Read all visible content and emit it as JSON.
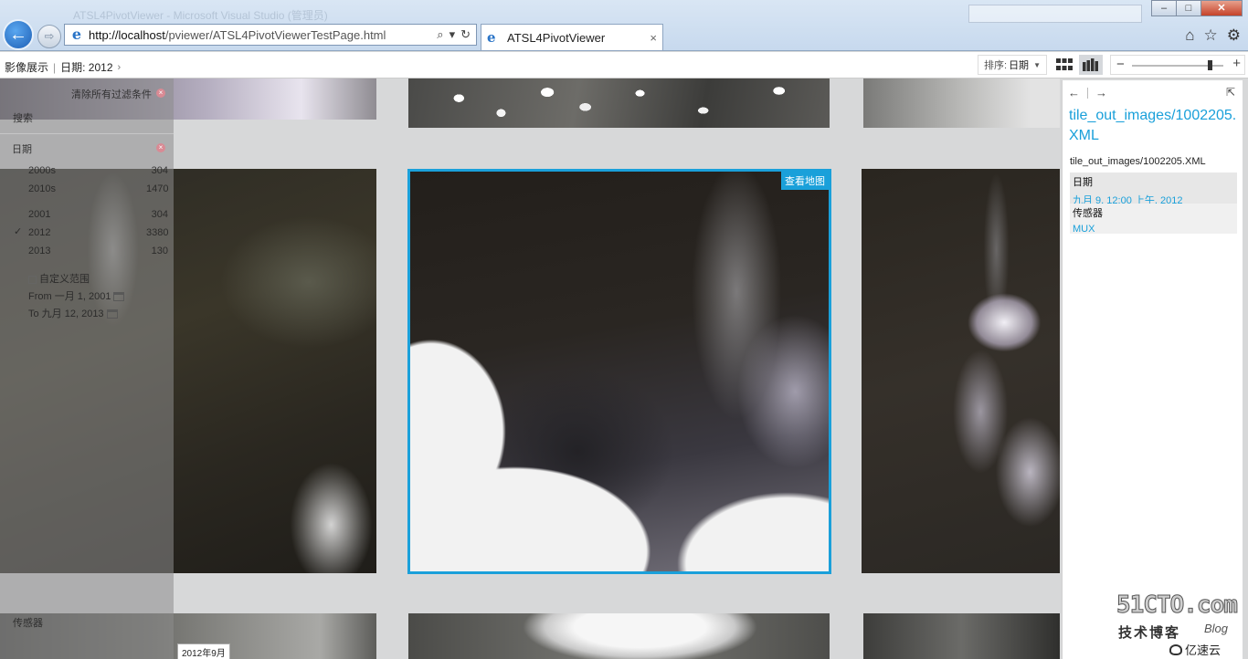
{
  "browser": {
    "window_title": "ATSL4PivotViewer - Microsoft Visual Studio (管理员)",
    "address_url_host": "http://localhost",
    "address_url_path": "/pviewer/ATSL4PivotViewerTestPage.html",
    "tab_title": "ATSL4PivotViewer",
    "tab_close": "×",
    "back_glyph": "←",
    "forward_glyph": "⇨",
    "search_glyph": "⌕",
    "dropdown_glyph": "▾",
    "refresh_glyph": "↻",
    "icons": {
      "home": "⌂",
      "favorites": "☆",
      "tools": "⚙"
    },
    "window_controls": {
      "minimize": "–",
      "maximize": "□",
      "close": "✕"
    }
  },
  "toolbar": {
    "breadcrumb_root": "影像展示",
    "breadcrumb_sep": "|",
    "breadcrumb_filter": "日期: 2012",
    "breadcrumb_chevron": "›",
    "sort_label": "排序:",
    "sort_value": "日期",
    "zoom_minus": "−",
    "zoom_plus": "+",
    "zoom_level": 0.86
  },
  "filter_panel": {
    "clear_all": "清除所有过滤条件",
    "search_label": "搜索",
    "search_count": "",
    "date_facet": "日期",
    "decades": [
      {
        "label": "2000s",
        "count": "304"
      },
      {
        "label": "2010s",
        "count": "1470"
      }
    ],
    "years": [
      {
        "label": "2001",
        "count": "304"
      },
      {
        "label": "2012",
        "count": "3380",
        "checked": true
      },
      {
        "label": "2013",
        "count": "130"
      }
    ],
    "custom_range": "自定义范围",
    "from": "From 一月 1, 2001",
    "to": "To 九月 12, 2013",
    "sensor_facet": "传感器"
  },
  "collection": {
    "selected_action": "查看地图",
    "bucket_tooltip": "2012年9月"
  },
  "details": {
    "nav_back": "←",
    "nav_forward": "→",
    "expand": "⇱",
    "title": "tile_out_images/1002205.XML",
    "subtitle": "tile_out_images/1002205.XML",
    "facets": [
      {
        "label": "日期",
        "value": "九月 9, 12:00 上午, 2012"
      },
      {
        "label": "传感器",
        "value": "MUX"
      }
    ]
  },
  "watermark": {
    "main": "51CTO.com",
    "sub": "技术博客",
    "blog": "Blog",
    "yisu": "亿速云"
  },
  "colors": {
    "accent": "#1aa0da",
    "chrome": "#c7d9ee",
    "panel": "#ffffff"
  }
}
